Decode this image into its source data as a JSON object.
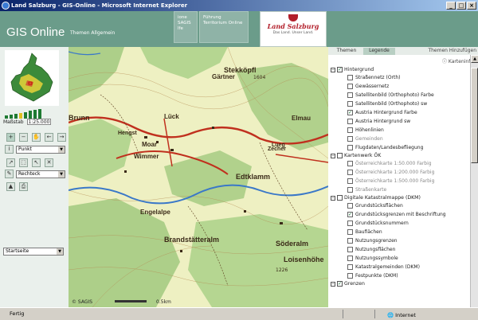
{
  "window": {
    "title": "Land Salzburg - GIS-Online - Microsoft Internet Explorer",
    "controls": [
      "_",
      "□",
      "×"
    ]
  },
  "header": {
    "app_name": "GIS Online",
    "subtitle": "Themen Allgemein",
    "nav": [
      {
        "label": "ione\nSAGIS\nlfe"
      },
      {
        "label": "Führung\nTerritorium Online"
      }
    ],
    "logo_text": "Land Salzburg",
    "logo_subtext": "Das Land. Unser Land."
  },
  "left_panel": {
    "scale_label": "Maßstab",
    "scale_value": "1:25.000",
    "zoom_levels": 8,
    "zoom_active": 3,
    "selects": [
      {
        "id": "punkt",
        "value": "Punkt"
      },
      {
        "id": "rechteck",
        "value": "Rechteck"
      }
    ],
    "bottom_select": "Startseite"
  },
  "map": {
    "labels": [
      "Stekköpfl",
      "Brunn",
      "Hengst",
      "Gärtner",
      "Moar",
      "Lück",
      "Wimmer",
      "Zecher",
      "Elmau",
      "Edtklamm",
      "Engelalpe",
      "Lueg",
      "Brandstätteralm",
      "Söderalm",
      "Loisenhöhe"
    ],
    "elevation_labels": [
      "1604",
      "1226"
    ],
    "copyright": "© SAGIS",
    "scale_text": "0.5km"
  },
  "right_panel": {
    "tabs": [
      {
        "label": "Themen",
        "active": false
      },
      {
        "label": "Legende",
        "active": true
      }
    ],
    "tabs_link": "Themen Hinzufügen",
    "map_info": "Karteninfo",
    "groups": [
      {
        "label": "Hintergrund",
        "checked": true,
        "expanded": true,
        "items": [
          {
            "label": "Straßennetz (Orth)",
            "checked": false,
            "enabled": true
          },
          {
            "label": "Gewässernetz",
            "checked": false,
            "enabled": true
          },
          {
            "label": "Satellitenbild (Orthophoto) Farbe",
            "checked": false,
            "enabled": true
          },
          {
            "label": "Satellitenbild (Orthophoto) sw",
            "checked": false,
            "enabled": true
          },
          {
            "label": "Austria Hintergrund Farbe",
            "checked": true,
            "enabled": true
          },
          {
            "label": "Austria Hintergrund sw",
            "checked": false,
            "enabled": true
          },
          {
            "label": "Höhenlinien",
            "checked": false,
            "enabled": true
          },
          {
            "label": "Gemeinden",
            "checked": false,
            "enabled": false
          },
          {
            "label": "Flugdaten/Landesbefliegung",
            "checked": false,
            "enabled": true
          }
        ]
      },
      {
        "label": "Kartenwerk ÖK",
        "checked": false,
        "expanded": true,
        "items": [
          {
            "label": "Österreichkarte 1:50.000 Farbig",
            "checked": false,
            "enabled": false
          },
          {
            "label": "Österreichkarte 1:200.000 Farbig",
            "checked": false,
            "enabled": false
          },
          {
            "label": "Österreichkarte 1:500.000 Farbig",
            "checked": false,
            "enabled": false
          },
          {
            "label": "Straßenkarte",
            "checked": false,
            "enabled": false
          }
        ]
      },
      {
        "label": "Digitale Katastralmappe (DKM)",
        "checked": false,
        "expanded": true,
        "items": [
          {
            "label": "Grundstücksflächen",
            "checked": false,
            "enabled": true
          },
          {
            "label": "Grundstücksgrenzen mit Beschriftung",
            "checked": true,
            "enabled": true
          },
          {
            "label": "Grundstücksnummern",
            "checked": false,
            "enabled": true
          },
          {
            "label": "Baufiächen",
            "checked": false,
            "enabled": true
          },
          {
            "label": "Nutzungsgrenzen",
            "checked": false,
            "enabled": true
          },
          {
            "label": "Nutzungsflächen",
            "checked": false,
            "enabled": true
          },
          {
            "label": "Nutzungssymbole",
            "checked": false,
            "enabled": true
          },
          {
            "label": "Katastralgemeinden (DKM)",
            "checked": false,
            "enabled": true
          },
          {
            "label": "Festpunkte (DKM)",
            "checked": false,
            "enabled": true
          }
        ]
      },
      {
        "label": "Grenzen",
        "checked": true,
        "expanded": true,
        "items": []
      }
    ]
  },
  "statusbar": {
    "left_text": "Fertig",
    "zone_text": "Internet"
  },
  "colors": {
    "header_bg": "#6b9c8a",
    "title_gradient_start": "#0a246a",
    "title_gradient_end": "#a6caf0",
    "map_bg": "#eef0c2",
    "forest": "#9cc77a",
    "road_red": "#c0301e",
    "river_blue": "#3a78c8",
    "logo_red": "#b21e2a"
  }
}
